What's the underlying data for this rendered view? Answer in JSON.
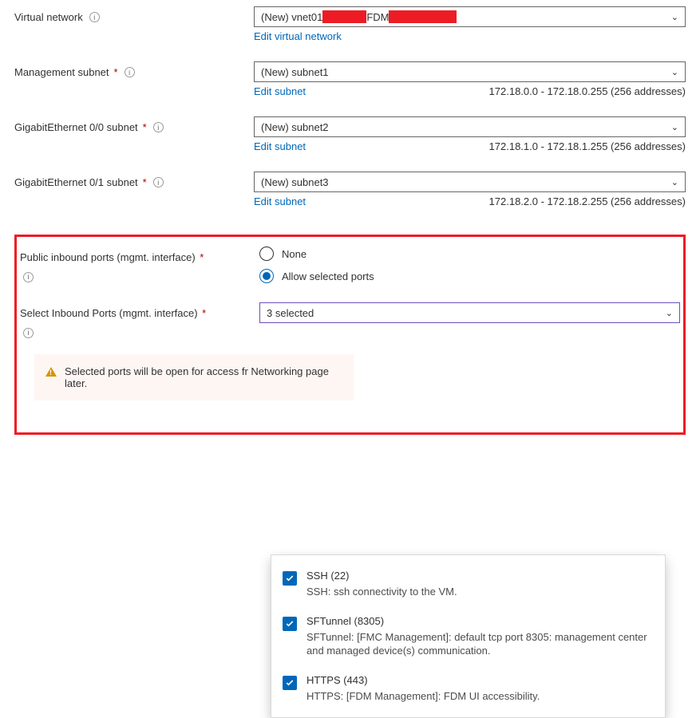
{
  "vnet": {
    "label": "Virtual network",
    "prefix": "(New) vnet01",
    "mid": "FDM",
    "edit": "Edit virtual network"
  },
  "mgmt": {
    "label": "Management subnet",
    "value": "(New) subnet1",
    "edit": "Edit subnet",
    "range": "172.18.0.0 - 172.18.0.255 (256 addresses)"
  },
  "ge00": {
    "label": "GigabitEthernet 0/0 subnet",
    "value": "(New) subnet2",
    "edit": "Edit subnet",
    "range": "172.18.1.0 - 172.18.1.255 (256 addresses)"
  },
  "ge01": {
    "label": "GigabitEthernet 0/1 subnet",
    "value": "(New) subnet3",
    "edit": "Edit subnet",
    "range": "172.18.2.0 - 172.18.2.255 (256 addresses)"
  },
  "inbound": {
    "label": "Public inbound ports (mgmt. interface)",
    "opt_none": "None",
    "opt_allow": "Allow selected ports"
  },
  "selectPorts": {
    "label": "Select Inbound Ports (mgmt. interface)",
    "summary": "3 selected"
  },
  "warn": {
    "line": "Selected ports will be open for access fr Networking page later."
  },
  "ports": {
    "ssh": {
      "title": "SSH (22)",
      "desc": "SSH: ssh connectivity to the VM."
    },
    "sft": {
      "title": "SFTunnel (8305)",
      "desc": "SFTunnel: [FMC Management]: default tcp port 8305: management center and managed device(s) communication."
    },
    "https": {
      "title": "HTTPS (443)",
      "desc": "HTTPS: [FDM Management]: FDM UI accessibility."
    }
  }
}
